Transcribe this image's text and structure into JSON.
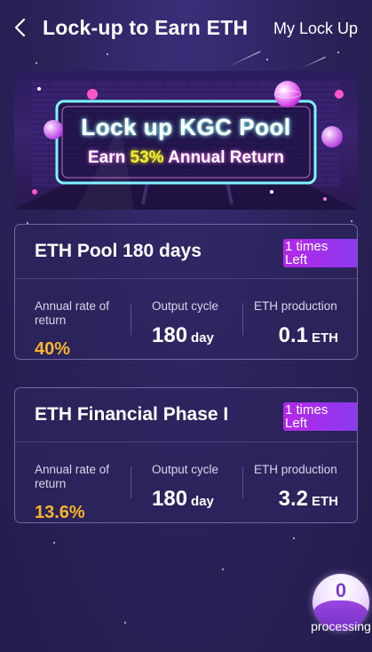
{
  "header": {
    "title": "Lock-up to Earn ETH",
    "my_lockup_label": "My Lock Up"
  },
  "banner": {
    "line1": "Lock up KGC Pool",
    "line2_prefix": "Earn ",
    "line2_highlight": "53%",
    "line2_suffix": " Annual Return"
  },
  "pools": [
    {
      "name": "ETH Pool 180 days",
      "badge_line1": "1 times",
      "badge_line2": "Left",
      "rate_label": "Annual rate of return",
      "rate_value": "40%",
      "cycle_label": "Output cycle",
      "cycle_value": "180",
      "cycle_unit": "day",
      "production_label": "ETH production",
      "production_value": "0.1",
      "production_unit": "ETH"
    },
    {
      "name": "ETH Financial Phase I",
      "badge_line1": "1 times",
      "badge_line2": "Left",
      "rate_label": "Annual rate of return",
      "rate_value": "13.6%",
      "cycle_label": "Output cycle",
      "cycle_value": "180",
      "cycle_unit": "day",
      "production_label": "ETH production",
      "production_value": "3.2",
      "production_unit": "ETH"
    }
  ],
  "processing": {
    "count": "0",
    "label": "processing"
  },
  "colors": {
    "background": "#2a2157",
    "rate_accent": "#f7b52b",
    "badge": "#a932ec",
    "card_border": "#6e68a2",
    "highlight_yellow": "#f8ef3a"
  }
}
